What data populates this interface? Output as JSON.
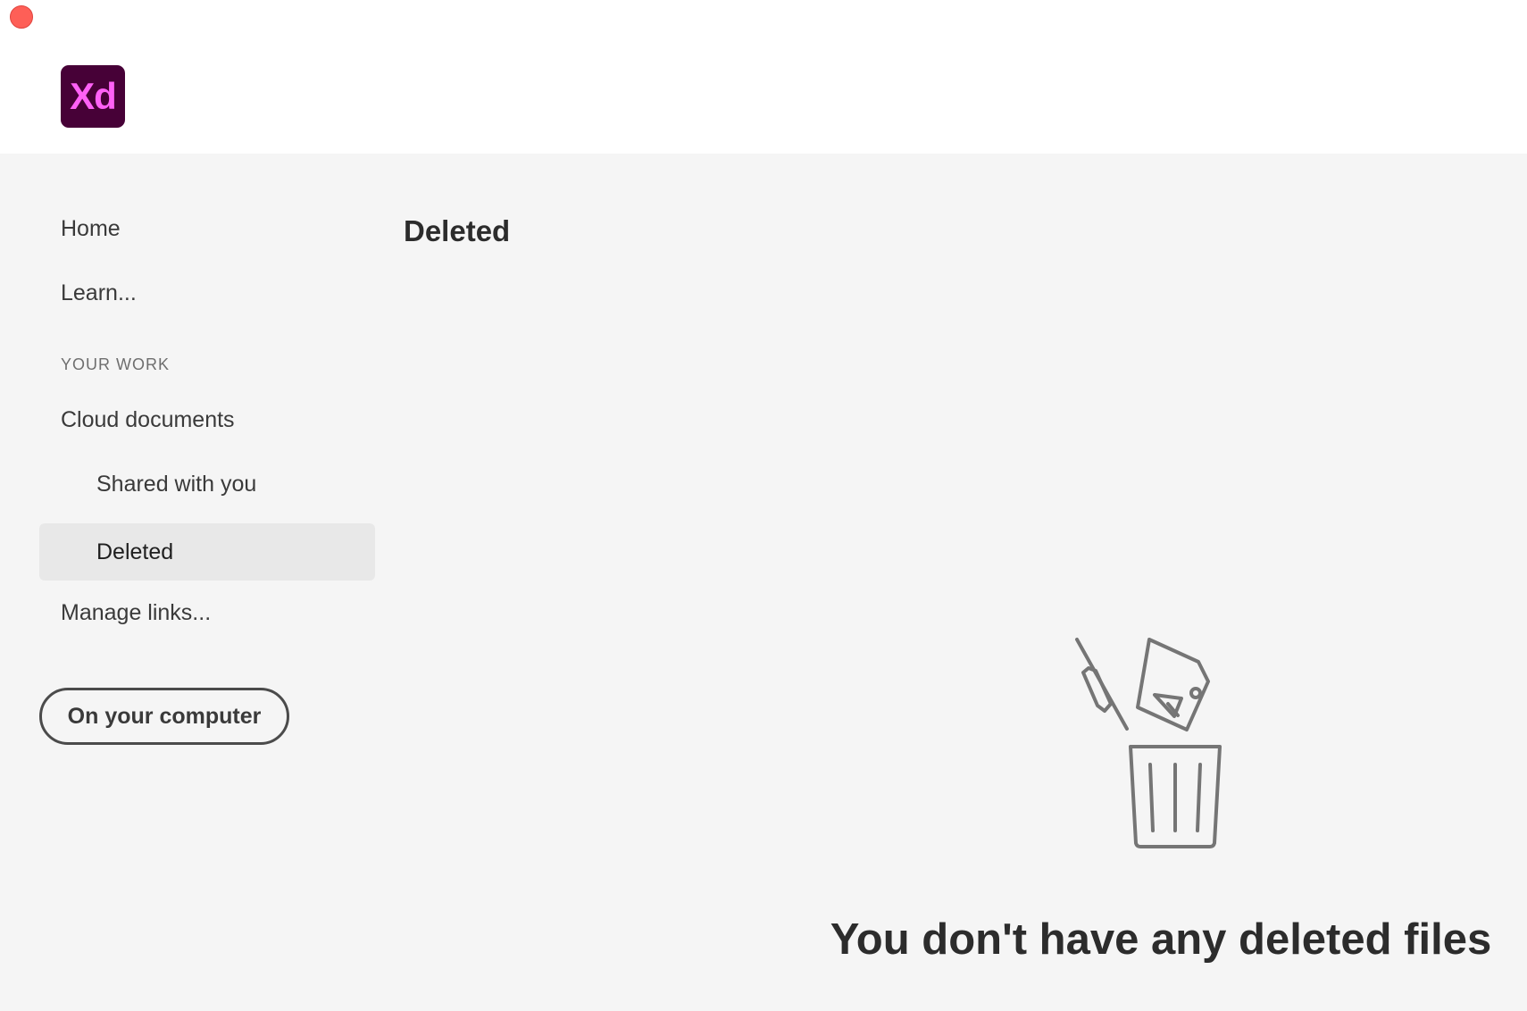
{
  "app": {
    "logo_text": "Xd",
    "brand_colors": {
      "logo_bg": "#470137",
      "logo_text": "#ff61f6"
    }
  },
  "window_controls": {
    "close_color": "#fe5f57"
  },
  "sidebar": {
    "items": [
      {
        "label": "Home"
      },
      {
        "label": "Learn..."
      }
    ],
    "section_label": "YOUR WORK",
    "work_items": [
      {
        "label": "Cloud documents"
      },
      {
        "label": "Shared with you"
      },
      {
        "label": "Deleted",
        "active": true
      },
      {
        "label": "Manage links..."
      }
    ],
    "computer_button_label": "On your computer"
  },
  "main": {
    "title": "Deleted",
    "empty_state": {
      "icon": "trash-with-files-icon",
      "message": "You don't have any deleted files"
    }
  }
}
